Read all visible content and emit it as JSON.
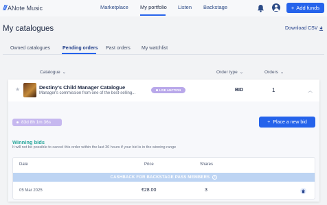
{
  "app": {
    "name": "ANote Music",
    "logo_mark": "///"
  },
  "nav": {
    "items": [
      "Marketplace",
      "My portfolio",
      "Listen",
      "Backstage"
    ],
    "active": "My portfolio"
  },
  "header_actions": {
    "add_funds_label": "Add funds",
    "add_icon": "plus-icon",
    "bell_icon": "bell-icon",
    "account_icon": "account-circle-icon"
  },
  "page": {
    "title": "My catalogues",
    "download_label": "Download CSV"
  },
  "tabs": [
    "Owned catalogues",
    "Pending orders",
    "Past orders",
    "My watchlist"
  ],
  "active_tab": "Pending orders",
  "columns": {
    "catalogue": "Catalogue",
    "order_type": "Order type",
    "orders": "Orders"
  },
  "order": {
    "title": "Destiny's Child Manager Catalogue",
    "description": "Manager's commission from one of the best-selling...",
    "badge": "LIVE AUCTION",
    "order_type": "BID",
    "orders_count": "1",
    "timer": "83d 8h 1m 36s",
    "place_bid_label": "Place a new bid"
  },
  "winning": {
    "title": "Winning bids",
    "note": "It will not be possible to cancel this order within the last 36 hours if your bid is in the winning range"
  },
  "bids_table": {
    "headers": {
      "date": "Date",
      "price": "Price",
      "shares": "Shares"
    },
    "banner": "CASHBACK FOR BACKSTAGE PASS MEMBERS",
    "rows": [
      {
        "date": "05 Mar 2025",
        "price": "€28.00",
        "shares": "3"
      }
    ]
  },
  "colors": {
    "accent": "#2563eb",
    "badge": "#b9a8ea",
    "timer": "#c6b8ef",
    "winning": "#26a69a",
    "banner": "#bdd4f3"
  }
}
